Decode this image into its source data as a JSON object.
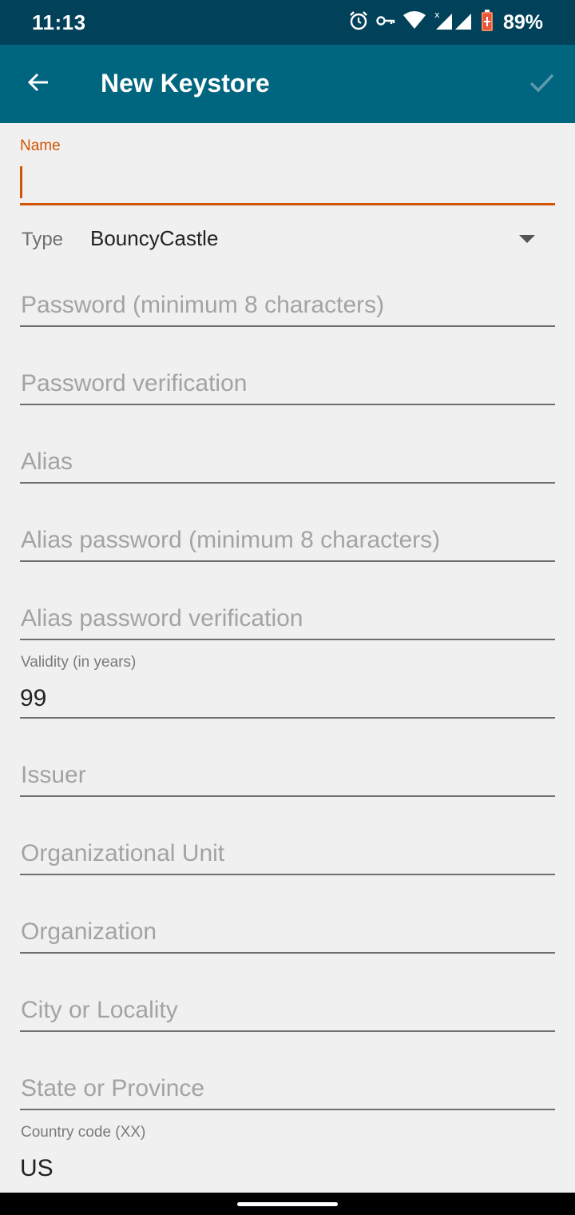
{
  "status_bar": {
    "time": "11:13",
    "battery": "89%",
    "icons": [
      "alarm-icon",
      "vpn-key-icon",
      "wifi-icon",
      "signal-icon",
      "battery-icon"
    ]
  },
  "app_bar": {
    "title": "New Keystore",
    "back_icon": "arrow-back-icon",
    "confirm_icon": "check-icon"
  },
  "form": {
    "name": {
      "label": "Name",
      "value": ""
    },
    "type": {
      "label": "Type",
      "value": "BouncyCastle"
    },
    "password": {
      "placeholder": "Password (minimum 8 characters)"
    },
    "password_verification": {
      "placeholder": "Password verification"
    },
    "alias": {
      "placeholder": "Alias"
    },
    "alias_password": {
      "placeholder": "Alias password (minimum 8 characters)"
    },
    "alias_password_verification": {
      "placeholder": "Alias password verification"
    },
    "validity": {
      "label": "Validity (in years)",
      "value": "99"
    },
    "issuer": {
      "placeholder": "Issuer"
    },
    "organizational_unit": {
      "placeholder": "Organizational Unit"
    },
    "organization": {
      "placeholder": "Organization"
    },
    "city": {
      "placeholder": "City or Locality"
    },
    "state": {
      "placeholder": "State or Province"
    },
    "country": {
      "label": "Country code (XX)",
      "value": "US"
    }
  },
  "colors": {
    "status_bar": "#014159",
    "app_bar": "#00657f",
    "accent": "#d35400",
    "background": "#f0f0f0"
  }
}
